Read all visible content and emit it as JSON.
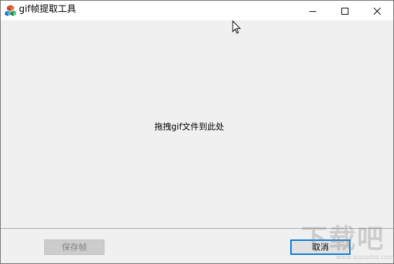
{
  "window": {
    "title": "gif帧提取工具",
    "icon": "app-cubes-icon",
    "controls": {
      "minimize_icon": "minimize-icon",
      "maximize_icon": "maximize-icon",
      "close_icon": "close-icon"
    }
  },
  "drop_area": {
    "hint": "拖拽gif文件到此处"
  },
  "buttons": {
    "save_frames": "保存帧",
    "cancel": "取消"
  },
  "watermark": {
    "text": "下载吧",
    "subtext": "www.xiazaiba.com"
  },
  "colors": {
    "accent": "#0078d7",
    "window_bg": "#f0f0f0",
    "disabled_button_bg": "#cccccc",
    "disabled_text": "#838383"
  }
}
